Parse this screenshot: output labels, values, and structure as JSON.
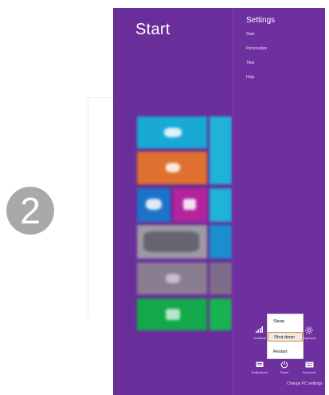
{
  "step": {
    "number": "2"
  },
  "start_screen": {
    "title": "Start"
  },
  "settings_charm": {
    "title": "Settings",
    "items": [
      "Start",
      "Personalize",
      "Tiles",
      "Help"
    ]
  },
  "power_menu": {
    "options": [
      "Sleep",
      "Shut down",
      "Restart"
    ],
    "highlighted": "Shut down",
    "highlight_color": "#e6862a"
  },
  "tray": {
    "network_label": "Available",
    "brightness_label": "Brightness",
    "notifications_label": "Notifications",
    "power_label": "Power",
    "keyboard_label": "Keyboard"
  },
  "footer": {
    "change_pc_settings": "Change PC settings"
  },
  "colors": {
    "background": "#6a2e9a",
    "tile_teal": "#19a9d5",
    "tile_orange": "#e0702f",
    "tile_blue": "#1b74c8",
    "tile_magenta": "#b3239b",
    "tile_green": "#13a84a",
    "tile_grey": "#8a7d91"
  },
  "icons": {
    "network": "signal-bars-icon",
    "brightness": "sun-icon",
    "notifications": "notifications-icon",
    "power": "power-icon",
    "keyboard": "keyboard-icon"
  }
}
